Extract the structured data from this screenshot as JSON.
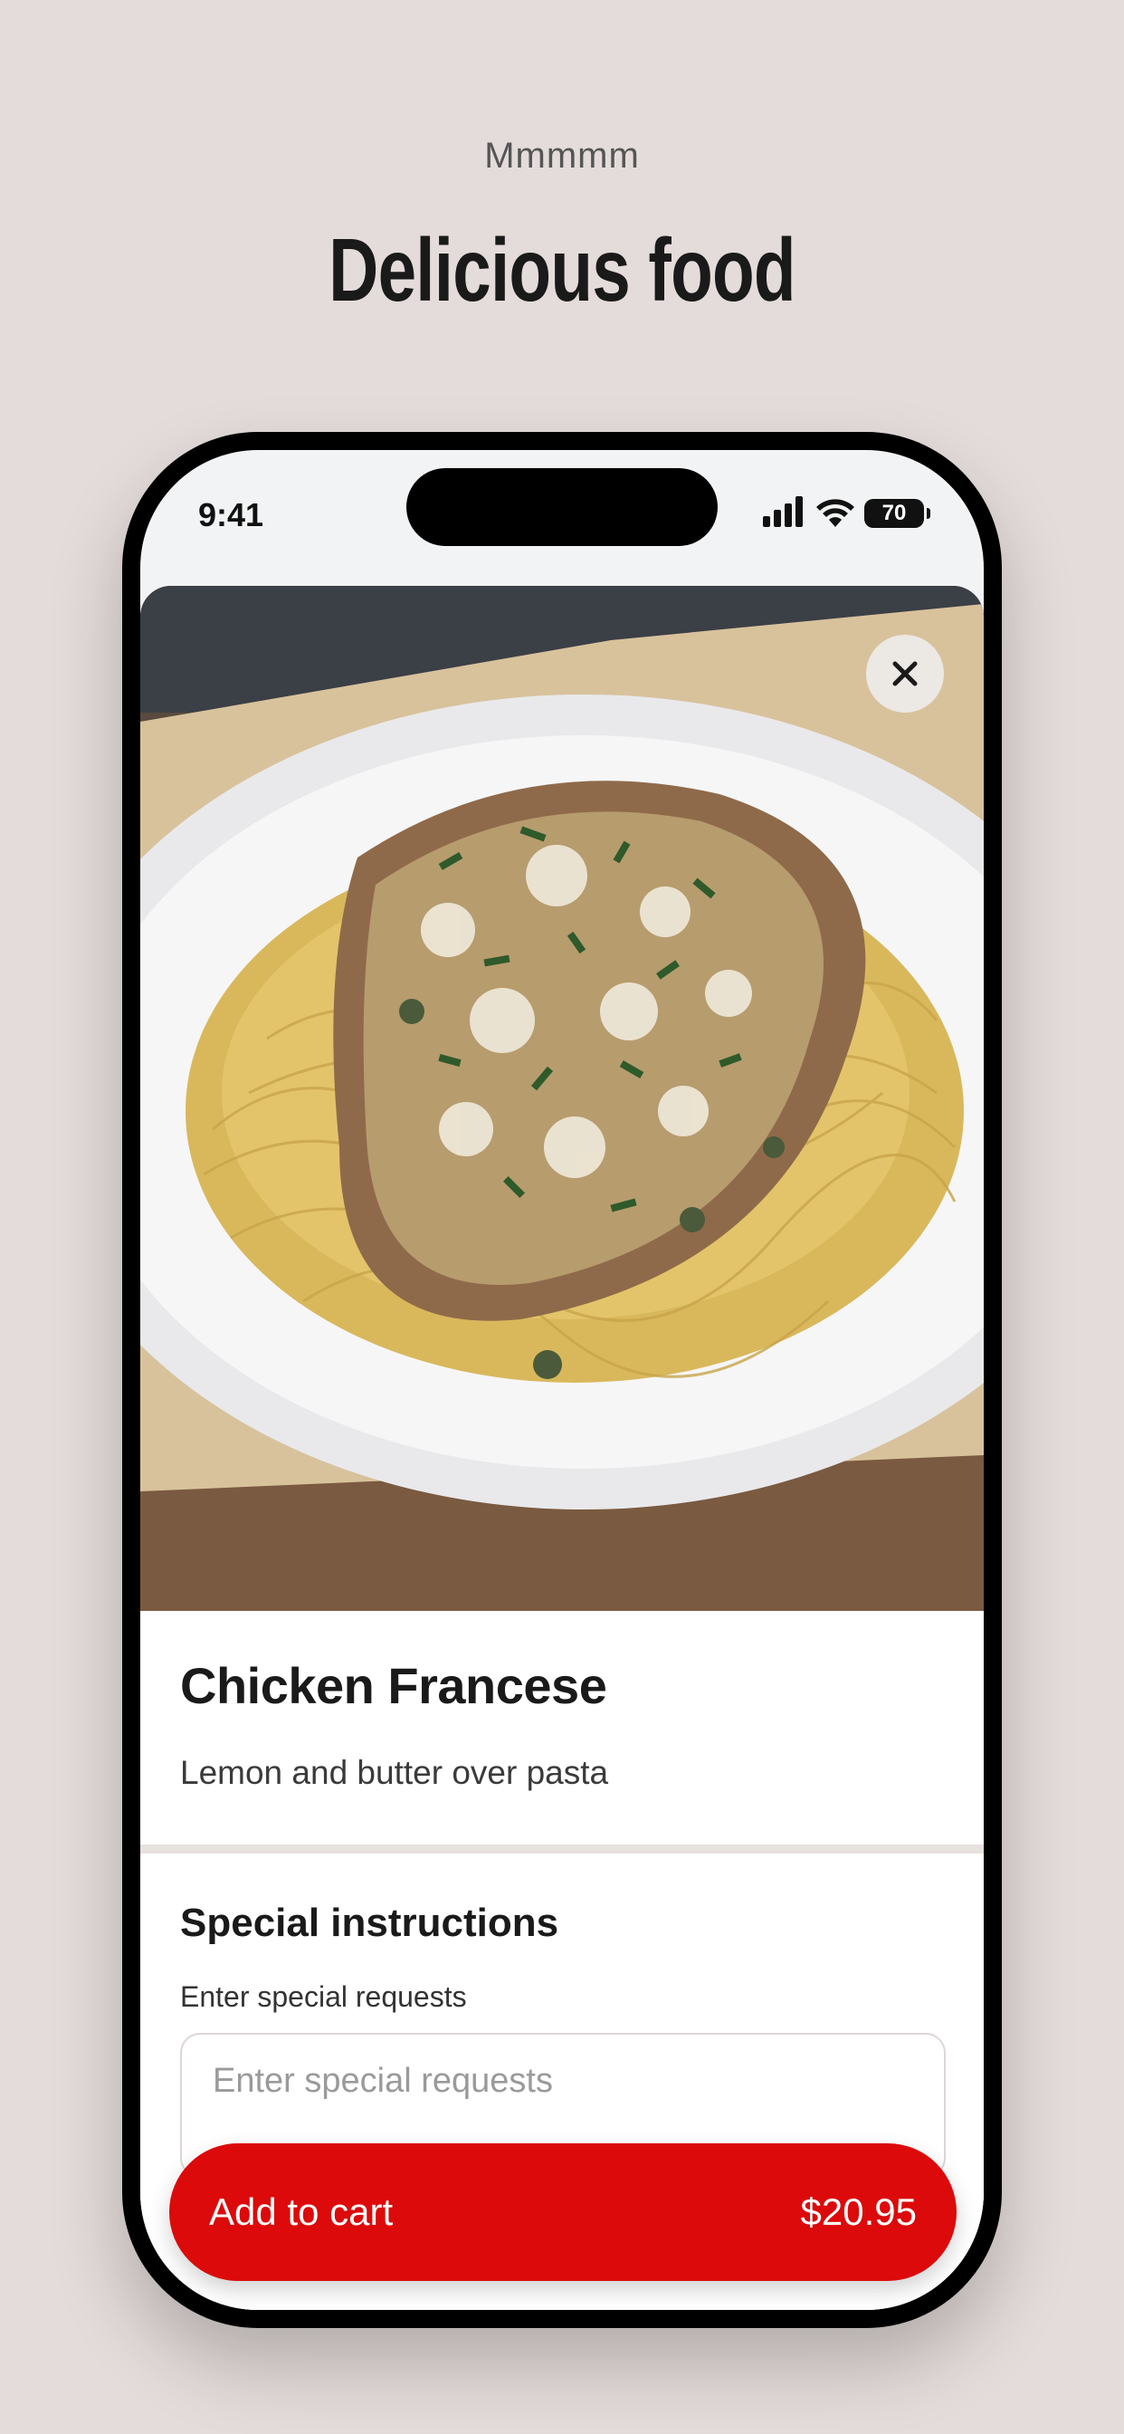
{
  "promo": {
    "eyebrow": "Mmmmm",
    "headline": "Delicious food"
  },
  "status_bar": {
    "time": "9:41",
    "battery": "70",
    "icons": [
      "signal-icon",
      "wifi-icon",
      "battery-icon"
    ]
  },
  "item": {
    "title": "Chicken Francese",
    "description": "Lemon and butter over pasta",
    "image": "chicken-francese-photo"
  },
  "special_instructions": {
    "title": "Special instructions",
    "label": "Enter special requests",
    "placeholder": "Enter special requests",
    "value": ""
  },
  "cart": {
    "label": "Add to cart",
    "price": "$20.95"
  },
  "colors": {
    "background": "#e4dcda",
    "accent": "#dc0a0a",
    "text": "#1a1a1a"
  }
}
